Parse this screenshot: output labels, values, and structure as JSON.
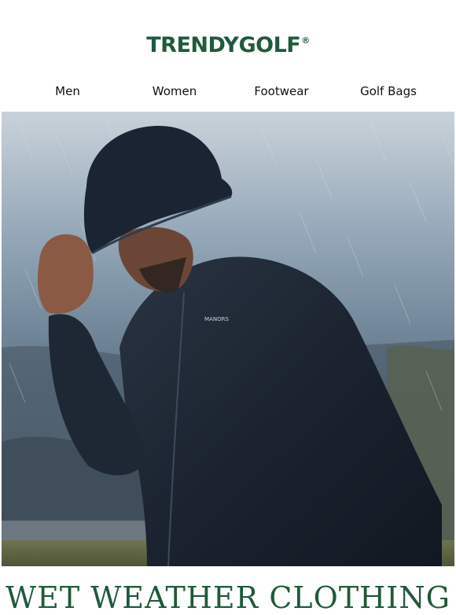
{
  "brand": {
    "logo_text": "TRENDYGOLF",
    "registered_mark": "®",
    "color": "#1f5a3b"
  },
  "nav": {
    "items": [
      {
        "label": "Men"
      },
      {
        "label": "Women"
      },
      {
        "label": "Footwear"
      },
      {
        "label": "Golf Bags"
      }
    ]
  },
  "hero": {
    "jacket_brand": "MANORS",
    "description_icon": "golfer-in-rain-photo"
  },
  "headline": {
    "text": "WET WEATHER CLOTHING"
  }
}
